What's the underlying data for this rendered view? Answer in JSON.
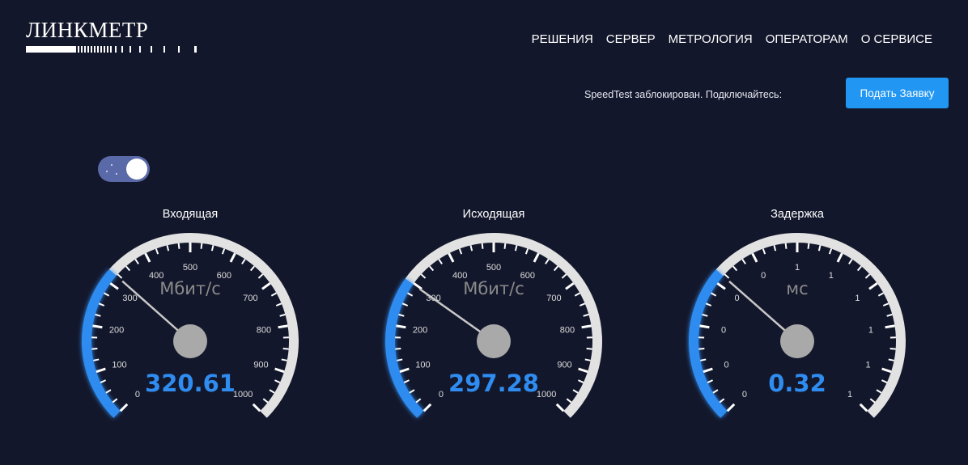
{
  "header": {
    "logo_text": "ЛИНКМЕТР",
    "nav": [
      "РЕШЕНИЯ",
      "СЕРВЕР",
      "МЕТРОЛОГИЯ",
      "ОПЕРАТОРАМ",
      "О СЕРВИСЕ"
    ]
  },
  "notice": {
    "text": "SpeedTest  заблокирован. Подключайтесь:",
    "button_label": "Подать Заявку"
  },
  "theme_toggle": {
    "state": "dark"
  },
  "colors": {
    "background": "#13172b",
    "accent": "#2f8cf0",
    "dial": "#e2e2e2",
    "needle_hub": "#a9a9a9",
    "unit_text": "#8a8a8a"
  },
  "gauges": [
    {
      "title": "Входящая",
      "unit": "Мбит/с",
      "value_text": "320.61",
      "value": 320.61,
      "max": 1000,
      "tick_labels": [
        "0",
        "100",
        "200",
        "300",
        "400",
        "500",
        "600",
        "700",
        "800",
        "900",
        "1000"
      ]
    },
    {
      "title": "Исходящая",
      "unit": "Мбит/с",
      "value_text": "297.28",
      "value": 297.28,
      "max": 1000,
      "tick_labels": [
        "0",
        "100",
        "200",
        "300",
        "400",
        "500",
        "600",
        "700",
        "800",
        "900",
        "1000"
      ]
    },
    {
      "title": "Задержка",
      "unit": "мс",
      "value_text": "0.32",
      "value": 0.32,
      "max": 1,
      "tick_labels": [
        "0",
        "0",
        "0",
        "0",
        "0",
        "1",
        "1",
        "1",
        "1",
        "1",
        "1"
      ]
    }
  ]
}
